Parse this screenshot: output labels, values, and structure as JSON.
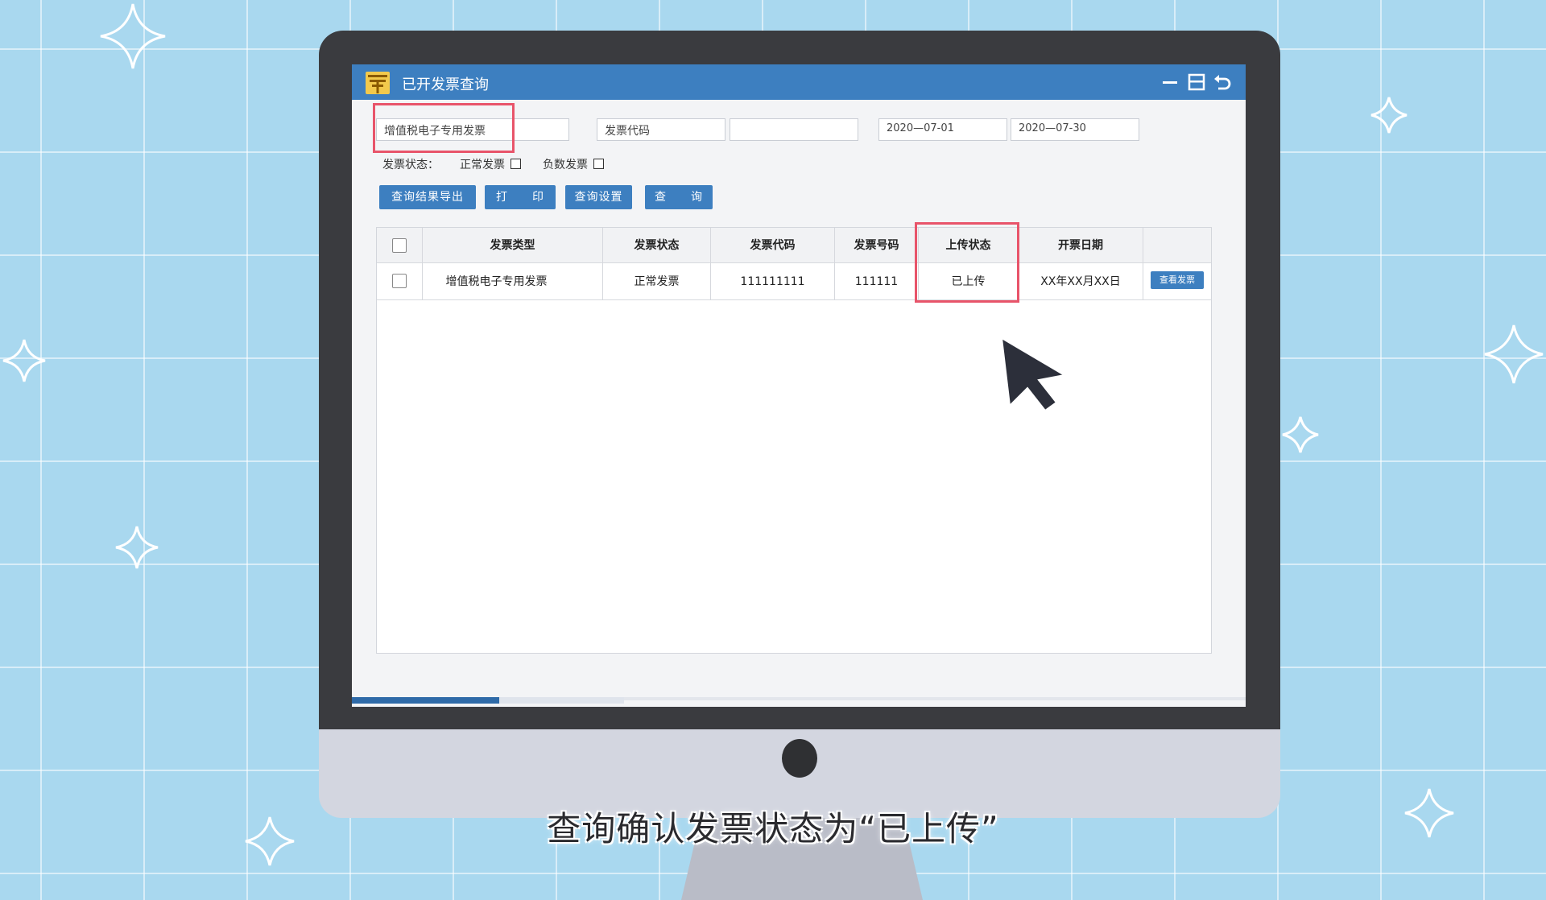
{
  "window": {
    "title": "已开发票查询",
    "icon": "ticket-icon",
    "controls": [
      "minimize-icon",
      "maximize-icon",
      "back-icon"
    ]
  },
  "filters": {
    "invoice_type": "增值税电子专用发票",
    "invoice_code_label": "发票代码",
    "invoice_code_value": "",
    "date_from": "2020—07-01",
    "date_to": "2020—07-30"
  },
  "status_filter": {
    "label": "发票状态：",
    "options": [
      {
        "label": "正常发票",
        "checked": false
      },
      {
        "label": "负数发票",
        "checked": false
      }
    ]
  },
  "buttons": {
    "export": "查询结果导出",
    "print": "打　　印",
    "settings": "查询设置",
    "query": "查　　询"
  },
  "table": {
    "headers": [
      "发票类型",
      "发票状态",
      "发票代码",
      "发票号码",
      "上传状态",
      "开票日期"
    ],
    "rows": [
      {
        "type": "增值税电子专用发票",
        "status": "正常发票",
        "code": "111111111",
        "number": "111111",
        "upload_status": "已上传",
        "date": "XX年XX月XX日",
        "action": "查看发票"
      }
    ]
  },
  "progress": {
    "fraction": 0.165
  },
  "subtitle": "查询确认发票状态为“已上传”",
  "colors": {
    "accent": "#3d7fc0",
    "highlight": "#e8546a",
    "background": "#a9d8ef"
  }
}
